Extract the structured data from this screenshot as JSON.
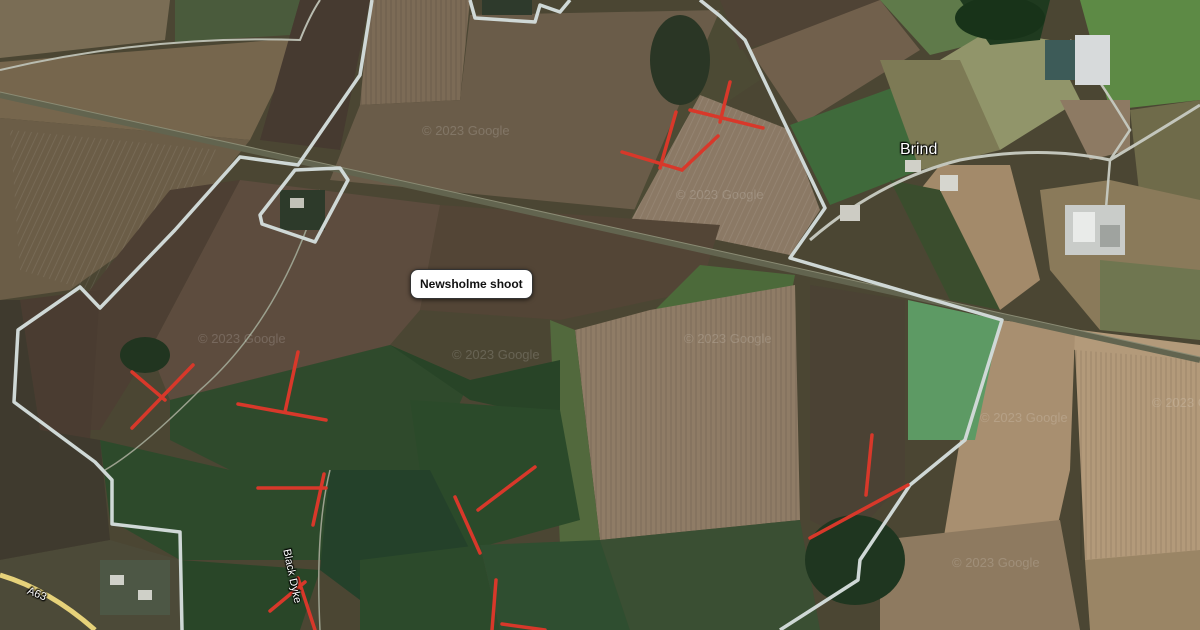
{
  "map": {
    "callout": "Newsholme shoot",
    "places": {
      "brind": "Brind"
    },
    "roads": {
      "a63": "A63",
      "black_dyke": "Black Dyke"
    },
    "watermark": "© 2023 Google",
    "colors": {
      "boundary": "#cfd8d6",
      "shoot_lines": "#d8382a",
      "railway": "#6d6f5a"
    }
  }
}
